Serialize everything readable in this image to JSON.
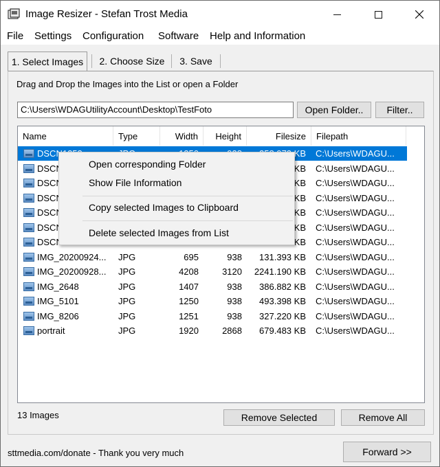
{
  "window": {
    "title": "Image Resizer - Stefan Trost Media"
  },
  "menu": [
    "File",
    "Settings",
    "Configuration",
    "Software",
    "Help and Information"
  ],
  "tabs": [
    "1. Select Images",
    "2. Choose Size",
    "3. Save"
  ],
  "select": {
    "group_label": "Drag and Drop the Images into the List or open a Folder",
    "folder_path": "C:\\Users\\WDAGUtilityAccount\\Desktop\\TestFoto",
    "open_folder_label": "Open Folder..",
    "filter_label": "Filter.."
  },
  "list": {
    "columns": [
      "Name",
      "Type",
      "Width",
      "Height",
      "Filesize",
      "Filepath"
    ],
    "rows": [
      {
        "name": "DSCN1253",
        "type": "JPG",
        "width": "1250",
        "height": "938",
        "size": "258.973 KB",
        "path": "C:\\Users\\WDAGU..."
      },
      {
        "name": "DSCN",
        "type": "",
        "width": "",
        "height": "",
        "size": "KB",
        "path": "C:\\Users\\WDAGU..."
      },
      {
        "name": "DSCN",
        "type": "",
        "width": "",
        "height": "",
        "size": "KB",
        "path": "C:\\Users\\WDAGU..."
      },
      {
        "name": "DSCN",
        "type": "",
        "width": "",
        "height": "",
        "size": "KB",
        "path": "C:\\Users\\WDAGU..."
      },
      {
        "name": "DSCN",
        "type": "",
        "width": "",
        "height": "",
        "size": "KB",
        "path": "C:\\Users\\WDAGU..."
      },
      {
        "name": "DSCN",
        "type": "",
        "width": "",
        "height": "",
        "size": "KB",
        "path": "C:\\Users\\WDAGU..."
      },
      {
        "name": "DSCN",
        "type": "",
        "width": "",
        "height": "",
        "size": "KB",
        "path": "C:\\Users\\WDAGU..."
      },
      {
        "name": "IMG_20200924...",
        "type": "JPG",
        "width": "695",
        "height": "938",
        "size": "131.393 KB",
        "path": "C:\\Users\\WDAGU..."
      },
      {
        "name": "IMG_20200928...",
        "type": "JPG",
        "width": "4208",
        "height": "3120",
        "size": "2241.190 KB",
        "path": "C:\\Users\\WDAGU..."
      },
      {
        "name": "IMG_2648",
        "type": "JPG",
        "width": "1407",
        "height": "938",
        "size": "386.882 KB",
        "path": "C:\\Users\\WDAGU..."
      },
      {
        "name": "IMG_5101",
        "type": "JPG",
        "width": "1250",
        "height": "938",
        "size": "493.398 KB",
        "path": "C:\\Users\\WDAGU..."
      },
      {
        "name": "IMG_8206",
        "type": "JPG",
        "width": "1251",
        "height": "938",
        "size": "327.220 KB",
        "path": "C:\\Users\\WDAGU..."
      },
      {
        "name": "portrait",
        "type": "JPG",
        "width": "1920",
        "height": "2868",
        "size": "679.483 KB",
        "path": "C:\\Users\\WDAGU..."
      }
    ]
  },
  "context_menu": {
    "items": [
      "Open corresponding Folder",
      "Show File Information",
      "Copy selected Images to Clipboard",
      "Delete selected Images from List"
    ]
  },
  "status": {
    "count": "13 Images",
    "remove_selected_label": "Remove Selected",
    "remove_all_label": "Remove All"
  },
  "footer": {
    "donate_text": "sttmedia.com/donate - Thank you very much",
    "forward_label": "Forward >>"
  },
  "colors": {
    "selection": "#0078d7",
    "window_bg": "#f0f0f0"
  }
}
